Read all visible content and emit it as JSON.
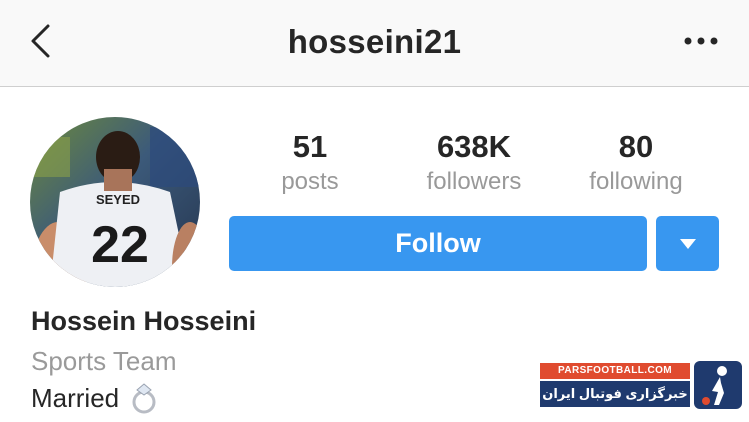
{
  "header": {
    "username": "hosseini21",
    "back_icon": "chevron-left-icon",
    "more_icon": "more-horizontal-icon"
  },
  "avatar": {
    "jersey_name": "SEYED",
    "jersey_number": "22"
  },
  "stats": {
    "posts": {
      "value": "51",
      "label": "posts"
    },
    "followers": {
      "value": "638K",
      "label": "followers"
    },
    "following": {
      "value": "80",
      "label": "following"
    }
  },
  "actions": {
    "follow_label": "Follow",
    "dropdown_icon": "caret-down-icon"
  },
  "profile": {
    "full_name": "Hossein Hosseini",
    "category": "Sports Team",
    "bio": "Married",
    "bio_emoji_icon": "ring-icon"
  },
  "watermark": {
    "site": "PARSFOOTBALL.COM",
    "tagline": "خبرگزاری فوتبال ایران"
  },
  "colors": {
    "accent": "#3897f0",
    "text": "#262626",
    "muted": "#999999",
    "header_bg": "#f9f9f9"
  }
}
